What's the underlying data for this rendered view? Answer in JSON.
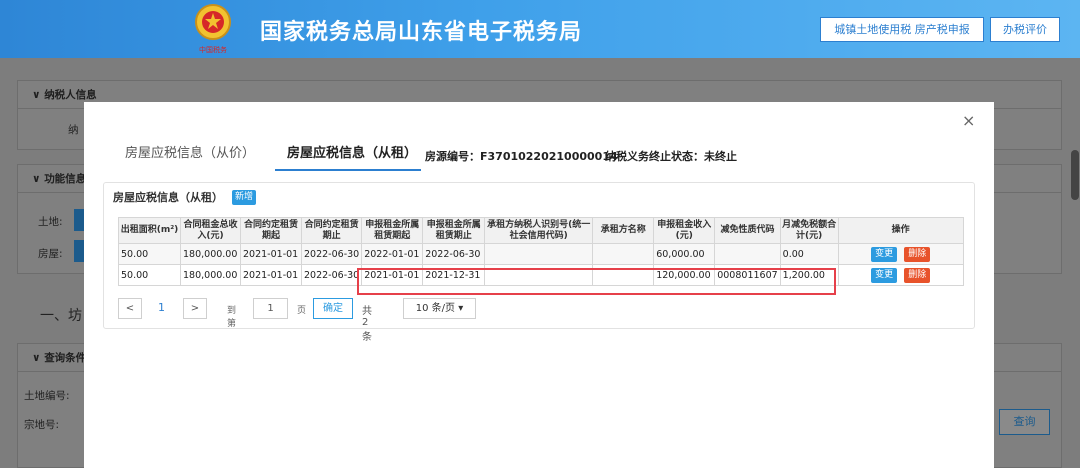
{
  "header": {
    "emblem_text": "中国税务",
    "title": "国家税务总局山东省电子税务局",
    "btn_land_tax": "城镇土地使用税 房产税申报",
    "btn_rating": "办税评价"
  },
  "background": {
    "panel1_title": "纳税人信息",
    "panel1_label": "纳",
    "panel2_title": "功能信息",
    "land_label": "土地:",
    "house_label": "房屋:",
    "section_heading": "一、坊",
    "panel3_title": "查询条件",
    "land_no_label": "土地编号:",
    "parcel_no_label": "宗地号:",
    "query_button": "查询"
  },
  "modal": {
    "close": "×",
    "tab_price": "房屋应税信息（从价）",
    "tab_rent": "房屋应税信息（从租）",
    "source_no_label": "房源编号：F37010220210000014",
    "status_label": "纳税义务终止状态：未终止",
    "panel_title": "房屋应税信息（从租）",
    "add_button": "新增",
    "table": {
      "headers": [
        "出租面积(m²)",
        "合同租金总收入(元)",
        "合同约定租赁期起",
        "合同约定租赁期止",
        "申报租金所属租赁期起",
        "申报租金所属租赁期止",
        "承租方纳税人识别号(统一社会信用代码)",
        "承租方名称",
        "申报租金收入(元)",
        "减免性质代码",
        "月减免税额合计(元)",
        "操作"
      ],
      "rows": [
        [
          "50.00",
          "180,000.00",
          "2021-01-01",
          "2022-06-30",
          "2022-01-01",
          "2022-06-30",
          "",
          "",
          "60,000.00",
          "",
          "0.00"
        ],
        [
          "50.00",
          "180,000.00",
          "2021-01-01",
          "2022-06-30",
          "2021-01-01",
          "2021-12-31",
          "",
          "",
          "120,000.00",
          "0008011607",
          "1,200.00"
        ]
      ],
      "edit_label": "变更",
      "delete_label": "删除"
    },
    "pager": {
      "prev": "<",
      "current": "1",
      "next": ">",
      "goto_label": "到第",
      "goto_value": "1",
      "page_unit": "页",
      "ok": "确定",
      "total": "共 2 条",
      "page_size": "10 条/页 ▾"
    }
  }
}
